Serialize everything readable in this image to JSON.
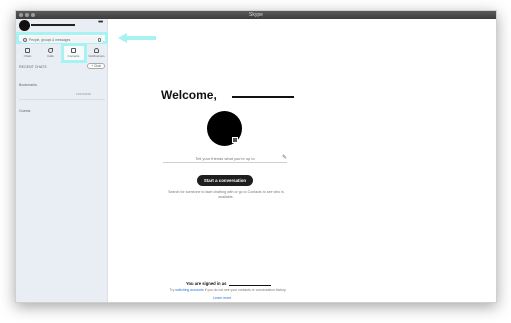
{
  "window": {
    "title": "Skype"
  },
  "sidebar": {
    "search_placeholder": "People, groups & messages",
    "tabs": [
      {
        "label": "Chats"
      },
      {
        "label": "Calls"
      },
      {
        "label": "Contacts"
      },
      {
        "label": "Notifications"
      }
    ],
    "recent_chats_label": "RECENT CHATS",
    "chat_button_label": "+ Chat",
    "row_one_label": "Bookmarks",
    "row_one_meta": "11/17/2019",
    "row_two_label": "Guests"
  },
  "main": {
    "welcome_text": "Welcome,",
    "mood_placeholder": "Tell your friends what you're up to",
    "start_button_label": "Start a conversation",
    "help_text": "Search for someone to start chatting with or go to Contacts to see who is available.",
    "signed_in_text": "You are signed in as",
    "existing_prefix": "Try",
    "existing_link": "switching accounts",
    "existing_suffix": "if you do not see your contacts or conversation history.",
    "learn_more": "Learn more"
  },
  "colors": {
    "highlight": "#a7f2f2",
    "link": "#2a74d6",
    "button": "#1e1e1e"
  }
}
